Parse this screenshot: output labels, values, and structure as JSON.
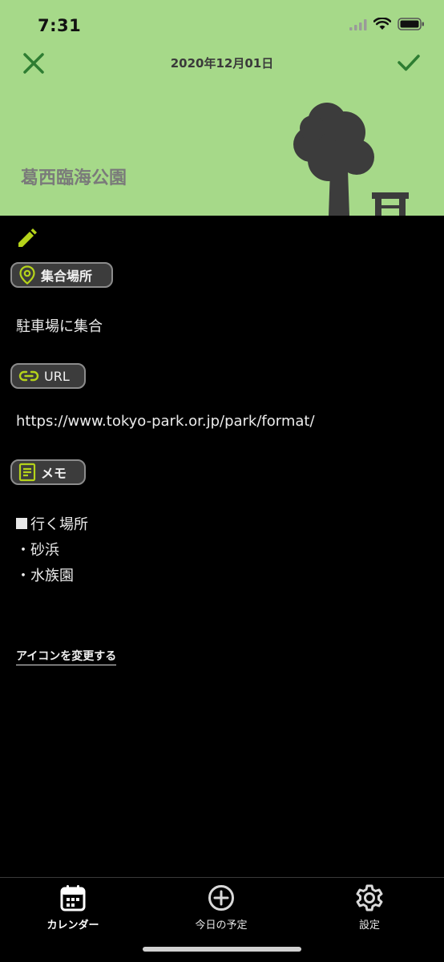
{
  "status_bar": {
    "time": "7:31"
  },
  "header": {
    "date": "2020年12月01日",
    "title": "葛西臨海公園",
    "icons": {
      "close": "close-icon",
      "confirm": "checkmark-icon",
      "illustration": "tree-and-bench-illustration"
    },
    "colors": {
      "background": "#a6d989",
      "accent": "#2e7d32"
    }
  },
  "sections": {
    "meeting_place": {
      "label": "集合場所",
      "icon": "location-pin-icon",
      "value": "駐車場に集合"
    },
    "url": {
      "label": "URL",
      "icon": "link-icon",
      "value": "https://www.tokyo-park.or.jp/park/format/"
    },
    "memo": {
      "label": "メモ",
      "icon": "note-icon",
      "lines": [
        "行く場所",
        "・砂浜",
        "・水族園"
      ]
    }
  },
  "accent_color": "#b5d31a",
  "change_icon_label": "アイコンを変更する",
  "tabbar": {
    "tabs": [
      {
        "label": "カレンダー",
        "icon": "calendar-icon",
        "active": true
      },
      {
        "label": "今日の予定",
        "icon": "plus-circle-icon",
        "active": false
      },
      {
        "label": "設定",
        "icon": "gear-icon",
        "active": false
      }
    ]
  }
}
